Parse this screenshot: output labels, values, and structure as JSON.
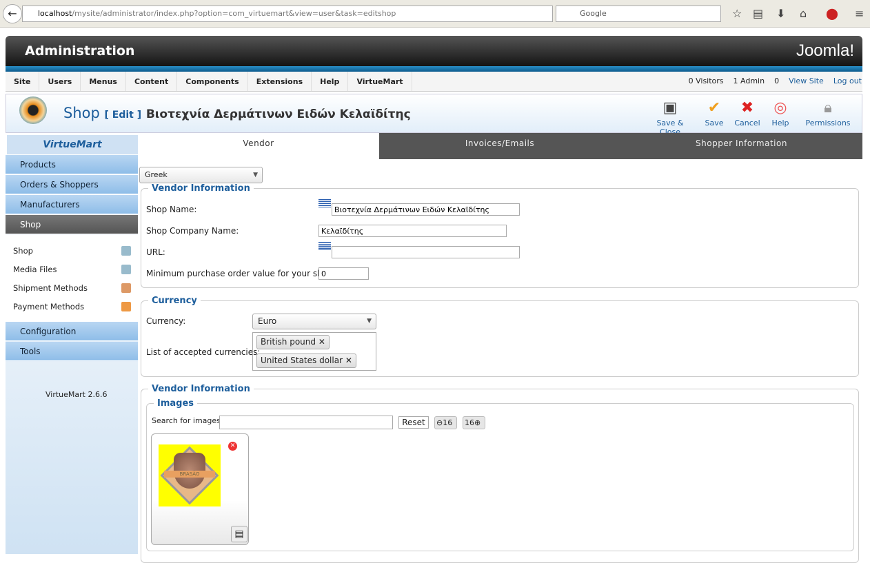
{
  "browser": {
    "url_host": "localhost",
    "url_path": "/mysite/administrator/index.php?option=com_virtuemart&view=user&task=editshop",
    "search_placeholder": "Google"
  },
  "header": {
    "title": "Administration",
    "logo": "Joomla!"
  },
  "menu": [
    "Site",
    "Users",
    "Menus",
    "Content",
    "Components",
    "Extensions",
    "Help",
    "VirtueMart"
  ],
  "status": {
    "visitors": "0 Visitors",
    "admin": "1 Admin",
    "messages": "0",
    "view_site": "View Site",
    "logout": "Log out"
  },
  "page": {
    "title": "Shop",
    "edit": "[ Edit ]",
    "name": "Βιοτεχνία Δερμάτινων Ειδών Κελαϊδίτης"
  },
  "toolbar": {
    "save_close": "Save & Close",
    "save": "Save",
    "cancel": "Cancel",
    "help": "Help",
    "permissions": "Permissions"
  },
  "sidebar": {
    "logo": "VirtueMart",
    "items": [
      "Products",
      "Orders & Shoppers",
      "Manufacturers",
      "Shop"
    ],
    "sub": [
      "Shop",
      "Media Files",
      "Shipment Methods",
      "Payment Methods"
    ],
    "items2": [
      "Configuration",
      "Tools"
    ],
    "version": "VirtueMart 2.6.6"
  },
  "tabs": [
    "Vendor",
    "Invoices/Emails",
    "Shopper Information"
  ],
  "language": "Greek",
  "vendor": {
    "legend": "Vendor Information",
    "shop_name_label": "Shop Name:",
    "shop_name": "Βιοτεχνία Δερμάτινων Ειδών Κελαϊδίτης",
    "company_label": "Shop Company Name:",
    "company": "Κελαϊδίτης",
    "url_label": "URL:",
    "url": "",
    "min_label": "Minimum purchase order value for your shop:",
    "min": "0"
  },
  "currency": {
    "legend": "Currency",
    "label": "Currency:",
    "value": "Euro",
    "accepted_label": "List of accepted currencies:",
    "accepted": [
      "British pound",
      "United States dollar"
    ]
  },
  "vendor2": {
    "legend": "Vendor Information",
    "images_legend": "Images",
    "search_label": "Search for images",
    "search_value": "",
    "reset": "Reset",
    "prev_count": "16",
    "next_count": "16",
    "image_text": "BRASÃO"
  }
}
